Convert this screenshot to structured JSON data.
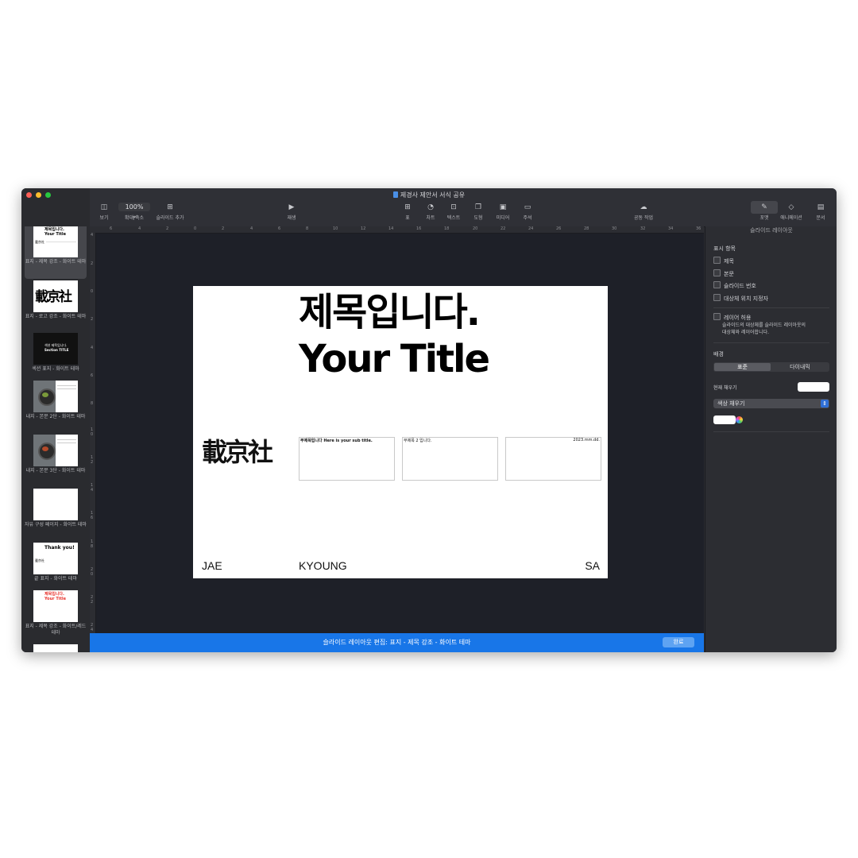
{
  "window": {
    "title": "제경사 제안서 서식 공유",
    "traffic_colors": [
      "#ff5f57",
      "#febc2e",
      "#28c840"
    ]
  },
  "toolbar": {
    "view": {
      "icon": "sidebar-icon",
      "label": "보기"
    },
    "zoom": {
      "value": "100% ⌄",
      "label": "확대/축소"
    },
    "add_slide": {
      "label": "슬라이드 추가"
    },
    "play": {
      "label": "재생"
    },
    "table": {
      "label": "표"
    },
    "chart": {
      "label": "차트"
    },
    "text": {
      "label": "텍스트"
    },
    "shape": {
      "label": "도형"
    },
    "media": {
      "label": "미디어"
    },
    "comment": {
      "label": "주석"
    },
    "collaborate": {
      "label": "공동 작업"
    },
    "format": {
      "label": "포맷"
    },
    "animate": {
      "label": "애니메이션"
    },
    "document": {
      "label": "문서"
    }
  },
  "thumbnails": [
    {
      "label": "표지 - 제목 강조 - 화이트 테마",
      "selected": true,
      "mini_title": "제목입니다.",
      "mini_sub": "Your Title",
      "mini_logo": "載京社"
    },
    {
      "label": "표지 - 로고 강조 - 화이트 테마",
      "mini_logo": "載京社"
    },
    {
      "label": "섹션 표지 - 화이트 테마",
      "mini_title": "섹션 제목입니다.",
      "mini_sub": "Section TITLE"
    },
    {
      "label": "내지 - 본문 2단 - 화이트 테마"
    },
    {
      "label": "내지 - 본문 3단 - 화이트 테마"
    },
    {
      "label": "자유 구성 페이지 - 화이트 테마"
    },
    {
      "label": "끝 표지 - 화이트 테마",
      "mini_title": "Thank you!",
      "mini_logo": "載京社"
    },
    {
      "label": "표지 - 제목 강조 - 화이트/레드 테마",
      "mini_title": "제목입니다.",
      "mini_sub": "Your Title"
    }
  ],
  "ruler": {
    "top_ticks": [
      "6",
      "4",
      "2",
      "0",
      "2",
      "4",
      "6",
      "8",
      "10",
      "12",
      "14",
      "16",
      "18",
      "20",
      "22",
      "24",
      "26",
      "28",
      "30",
      "32",
      "34",
      "36"
    ],
    "left_ticks": [
      "4",
      "2",
      "0",
      "2",
      "4",
      "6",
      "8",
      "1\n0",
      "1\n2",
      "1\n4",
      "1\n6",
      "1\n8",
      "2\n0",
      "2\n2",
      "2\n4"
    ]
  },
  "slide": {
    "title_ko": "제목입니다.",
    "title_en": "Your Title",
    "logo": "載京社",
    "box1": "부제목입니다 Here is your sub title.",
    "box2": "부제목 2 입니다.",
    "box3": "2023.mm.dd.",
    "footer_left": "JAE",
    "footer_mid": "KYOUNG",
    "footer_right": "SA"
  },
  "statusbar": {
    "text": "슬라이드 레이아웃 편집: 표지 - 제목 강조 - 화이트 테마",
    "done": "완료",
    "color": "#1876e8"
  },
  "inspector": {
    "header": "슬라이드 레이아웃",
    "show_section": "표시 항목",
    "items": [
      "제목",
      "본문",
      "슬라이드 번호",
      "대상체 위치 지정자"
    ],
    "allow_layering": "레이어 허용",
    "allow_desc_1": "슬라이드의 대상체를 슬라이드 레이아웃의",
    "allow_desc_2": "대상체와 레이어합니다.",
    "background": "배경",
    "seg_standard": "표준",
    "seg_dynamic": "다이내믹",
    "current_fill": "현재 채우기",
    "fill_type": "색상 채우기",
    "fill_color": "#ffffff"
  }
}
